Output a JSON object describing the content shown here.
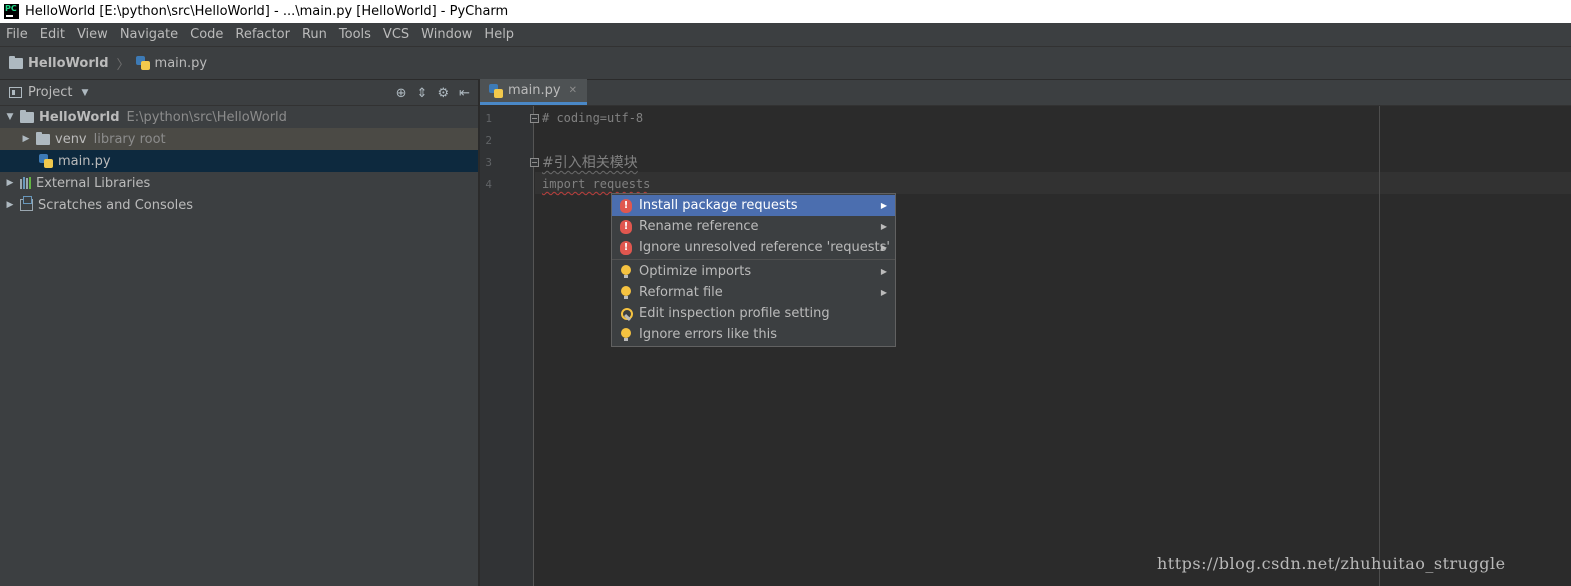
{
  "window": {
    "title": "HelloWorld [E:\\python\\src\\HelloWorld] - ...\\main.py [HelloWorld] - PyCharm",
    "logo_text": "PC"
  },
  "menu": [
    "File",
    "Edit",
    "View",
    "Navigate",
    "Code",
    "Refactor",
    "Run",
    "Tools",
    "VCS",
    "Window",
    "Help"
  ],
  "navbar": {
    "project": "HelloWorld",
    "file": "main.py"
  },
  "project_panel": {
    "title": "Project",
    "tree": [
      {
        "label": "HelloWorld",
        "hint": "E:\\python\\src\\HelloWorld"
      },
      {
        "label": "venv",
        "hint": "library root"
      },
      {
        "label": "main.py"
      },
      {
        "label": "External Libraries"
      },
      {
        "label": "Scratches and Consoles"
      }
    ]
  },
  "editor": {
    "tab": "main.py",
    "line_numbers": [
      "1",
      "2",
      "3",
      "4"
    ],
    "lines": [
      "# coding=utf-8",
      "",
      "#引入相关模块",
      "import requests"
    ]
  },
  "intentions": [
    {
      "label": "Install package requests",
      "icon": "error-icon",
      "submenu": true
    },
    {
      "label": "Rename reference",
      "icon": "error-icon",
      "submenu": true
    },
    {
      "label": "Ignore unresolved reference 'requests'",
      "icon": "error-icon",
      "submenu": true
    },
    {
      "label": "Optimize imports",
      "icon": "bulb-icon",
      "submenu": true
    },
    {
      "label": "Reformat file",
      "icon": "bulb-icon",
      "submenu": true
    },
    {
      "label": "Edit inspection profile setting",
      "icon": "wrench-icon",
      "submenu": false
    },
    {
      "label": "Ignore errors like this",
      "icon": "bulb-icon",
      "submenu": false
    }
  ],
  "watermark": "https://blog.csdn.net/zhuhuitao_struggle",
  "colors": {
    "selection": "#0d293e",
    "popup_active": "#4b6eaf",
    "error": "#e0574f",
    "bulb": "#f5c240"
  }
}
